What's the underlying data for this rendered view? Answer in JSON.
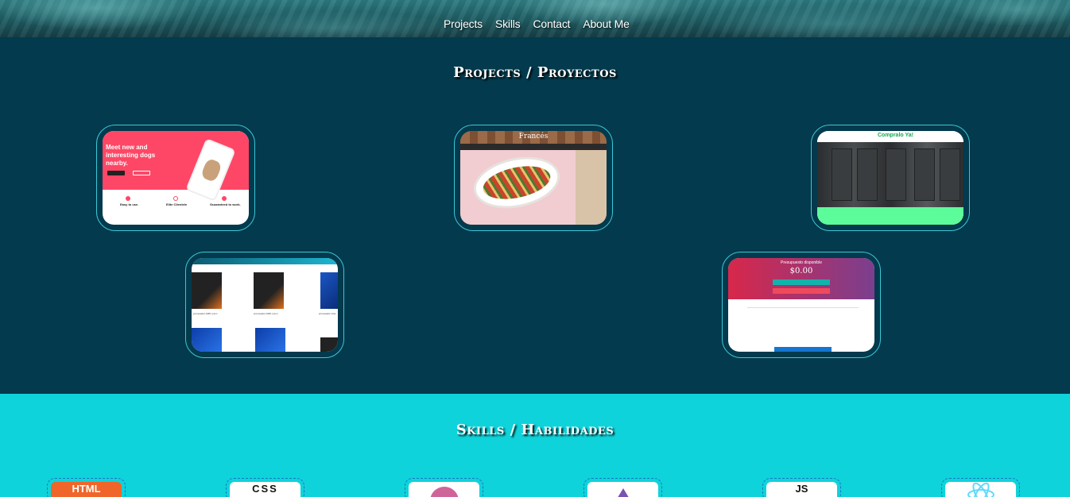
{
  "nav": {
    "items": [
      "Projects",
      "Skills",
      "Contact",
      "About Me"
    ]
  },
  "projects": {
    "title": "Projects / Proyectos",
    "cards": [
      {
        "name": "dog-app",
        "text": [
          "Meet new and",
          "interesting dogs",
          "nearby."
        ],
        "features": [
          "Easy to use.",
          "Elite Clientele",
          "Guaranteed to work."
        ]
      },
      {
        "name": "food-site",
        "header": "Francés"
      },
      {
        "name": "fridge-store",
        "brand": "Compralo Ya!"
      },
      {
        "name": "cpu-store",
        "items": [
          "procesador AMD ryzen",
          "procesador AMD ryzen",
          "procesador intel"
        ]
      },
      {
        "name": "budget-app",
        "heading": "Presupuesto disponible",
        "amount": "$0.00"
      }
    ]
  },
  "skills": {
    "title": "Skills / Habilidades",
    "items": [
      {
        "name": "html",
        "label": "HTML",
        "color": "#f06529"
      },
      {
        "name": "css",
        "label": "CSS",
        "color": "#111111"
      },
      {
        "name": "sass",
        "label": "",
        "color": "#cf649a"
      },
      {
        "name": "bootstrap",
        "label": "",
        "color": "#7952b3"
      },
      {
        "name": "js",
        "label": "JS",
        "color": "#111111"
      },
      {
        "name": "react",
        "label": "",
        "color": "#61dafb"
      }
    ]
  },
  "colors": {
    "projects_bg": "#033a4d",
    "skills_bg": "#0fd3da",
    "card_border": "#3cc7d6"
  }
}
